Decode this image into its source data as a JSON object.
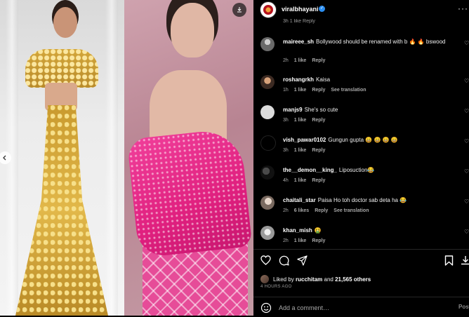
{
  "post": {
    "username": "viralbhayani",
    "verified": true,
    "cutoff_text": "3h   1 like   Reply"
  },
  "comments": [
    {
      "user": "maireee_sh",
      "text": "Bollywood should be renamed with b 🔥 🔥 bswood",
      "time": "2h",
      "likes": "1 like",
      "reply": "Reply",
      "see_translation": ""
    },
    {
      "user": "roshangrkh",
      "text": "Kaisa",
      "time": "1h",
      "likes": "1 like",
      "reply": "Reply",
      "see_translation": "See translation"
    },
    {
      "user": "manjs9",
      "text": "She's so cute",
      "time": "3h",
      "likes": "1 like",
      "reply": "Reply",
      "see_translation": ""
    },
    {
      "user": "vish_pawar0102",
      "text": "Gungun gupta 😄 😄 😄 😄",
      "time": "3h",
      "likes": "1 like",
      "reply": "Reply",
      "see_translation": ""
    },
    {
      "user": "the__demon__king_",
      "text": "Liposuction😂",
      "time": "4h",
      "likes": "1 like",
      "reply": "Reply",
      "see_translation": ""
    },
    {
      "user": "chaitali_star",
      "text": "Paisa Ho toh doctor sab deta ha 😂",
      "time": "2h",
      "likes": "6 likes",
      "reply": "Reply",
      "see_translation": "See translation"
    },
    {
      "user": "khan_mish",
      "text": "🤮",
      "time": "2h",
      "likes": "1 like",
      "reply": "Reply",
      "see_translation": ""
    }
  ],
  "likes": {
    "prefix": "Liked by",
    "user": "rucchitam",
    "middle": "and",
    "count": "21,565 others"
  },
  "time_ago": "4 HOURS AGO",
  "add_comment": {
    "placeholder": "Add a comment…",
    "post_label": "Post"
  },
  "icons": {
    "like": "heart-icon",
    "comment": "comment-icon",
    "share": "send-icon",
    "save": "bookmark-icon",
    "download": "download-icon",
    "emoji": "smiley-icon",
    "more": "more-icon",
    "carousel_prev": "chevron-left-icon"
  },
  "colors": {
    "background": "#000000",
    "verified": "#2b8ef0",
    "muted": "#a8a8a8"
  }
}
